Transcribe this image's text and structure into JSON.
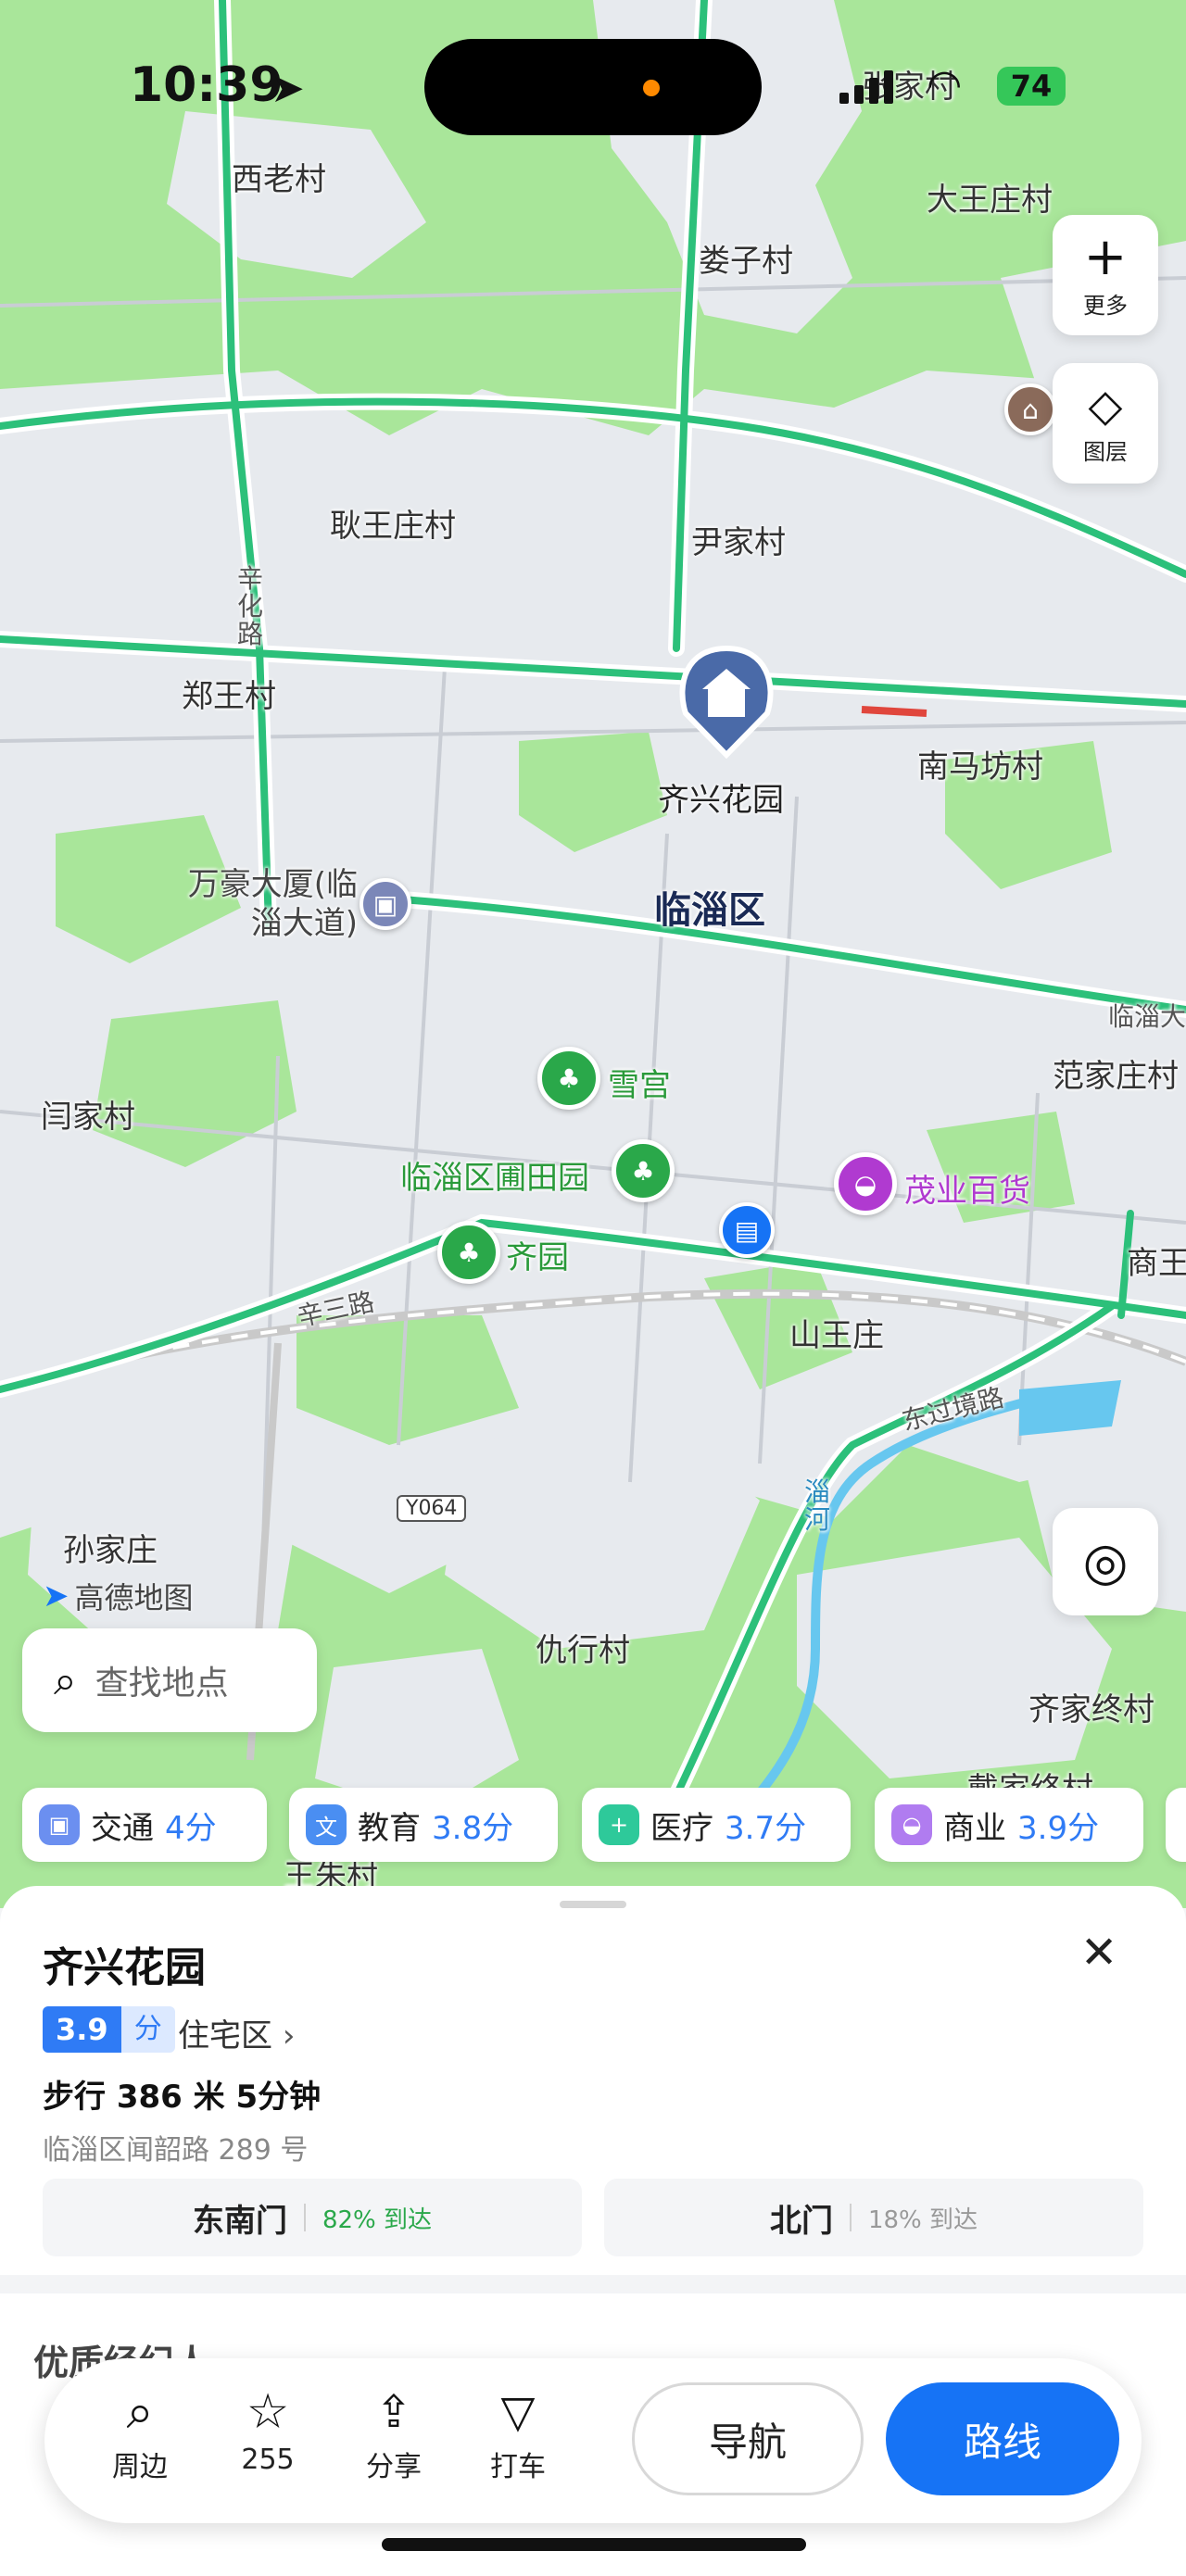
{
  "status_bar": {
    "time": "10:39",
    "battery": "74"
  },
  "map": {
    "colors": {
      "green_area": "#a9e69a",
      "urban_area": "#e7eaee",
      "road": "#2cc07a",
      "accent": "#1673f5"
    },
    "place_labels": {
      "xilaocun": "西老村",
      "zhangjiacun": "张家村",
      "dawangzhuangcun": "大王庄村",
      "louzicun": "娄子村",
      "gengwangzhuangcun": "耿王庄村",
      "yinjiacun": "尹家村",
      "xinhualu": "辛化路",
      "zhengwangcun": "郑王村",
      "qixinghuayuan": "齐兴花园",
      "nanmafangcun": "南马坊村",
      "wanhaodasha": "万豪大厦(临淄大道)",
      "linziqu": "临淄区",
      "xuegong": "雪宫",
      "fanjiazhuangcun": "范家庄村",
      "yanjiacun": "闫家村",
      "putianyuan": "临淄区圃田园",
      "maoyebaihuo": "茂业百货",
      "qiyuan": "齐园",
      "shang": "商王",
      "xinsanlu": "辛三路",
      "shanwangzhuang": "山王庄",
      "dongguojinglu": "东过境路",
      "zihe": "淄河",
      "sunjiazhuang": "孙家庄",
      "chouxingcun": "仇行村",
      "qijiazhongcun": "齐家终村",
      "daijiazhongcun": "戴家终村",
      "wangzhucun": "王朱村",
      "linzi_da": "临淄大",
      "road_shield": "Y064",
      "watermark": "高德地图"
    },
    "buttons": {
      "more_label": "更多",
      "layers_label": "图层"
    }
  },
  "search": {
    "placeholder": "查找地点"
  },
  "score_chips": [
    {
      "name": "交通",
      "score": "4分",
      "color": "#6b8ff0"
    },
    {
      "name": "教育",
      "score": "3.8分",
      "color": "#4a8ef2"
    },
    {
      "name": "医疗",
      "score": "3.7分",
      "color": "#2ec99a"
    },
    {
      "name": "商业",
      "score": "3.9分",
      "color": "#b07cf0"
    }
  ],
  "sheet": {
    "name": "齐兴花园",
    "score": "3.9",
    "score_unit": "分",
    "type": "住宅区",
    "walk_info": "步行 386 米 5分钟",
    "address": "临淄区闻韶路 289 号",
    "gates": [
      {
        "name": "东南门",
        "percent": "82% 到达",
        "color": "#2aa84a"
      },
      {
        "name": "北门",
        "percent": "18% 到达",
        "color": "#999999"
      }
    ],
    "section_title": "优质经纪人"
  },
  "toolbar": {
    "nearby": "周边",
    "favorites": "255",
    "share": "分享",
    "taxi": "打车",
    "navigate": "导航",
    "route": "路线"
  }
}
